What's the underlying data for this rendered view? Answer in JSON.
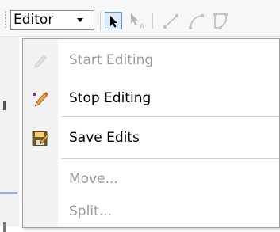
{
  "toolbar": {
    "editor_label": "Editor",
    "icons": [
      "select-arrow-icon",
      "edit-annotation-icon",
      "straight-segment-icon",
      "arc-segment-icon",
      "polygon-icon"
    ]
  },
  "menu": {
    "items": [
      {
        "label": "Start Editing",
        "enabled": false,
        "icon": "pencil-faded-icon"
      },
      {
        "label": "Stop Editing",
        "enabled": true,
        "icon": "pencil-icon"
      },
      {
        "label": "Save Edits",
        "enabled": true,
        "icon": "save-edits-icon"
      },
      {
        "label": "Move...",
        "enabled": false,
        "icon": ""
      },
      {
        "label": "Split...",
        "enabled": false,
        "icon": ""
      }
    ]
  },
  "colors": {
    "accent": "#5b9bd5",
    "disabled_text": "#9b9b9b",
    "menu_border": "#a0a0a0"
  }
}
